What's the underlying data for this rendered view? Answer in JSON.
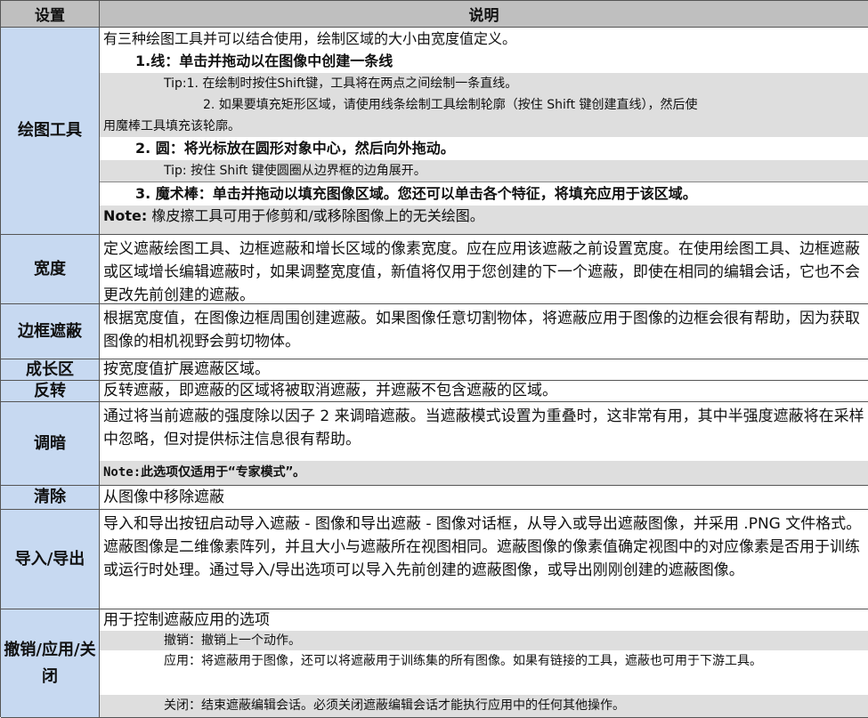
{
  "header": {
    "setting": "设置",
    "description": "说明"
  },
  "rows": {
    "draw": {
      "label": "绘图工具",
      "intro": "有三种绘图工具并可以结合使用，绘制区域的大小由宽度值定义。",
      "line_title": "1.线：单击并拖动以在图像中创建一条线",
      "line_tip1": "Tip:1. 在绘制时按住Shift键，工具将在两点之间绘制一条直线。",
      "line_tip2a": "2. 如果要填充矩形区域，请使用线条绘制工具绘制轮廓（按住 Shift 键创建直线），然后使",
      "line_tip2b": "用魔棒工具填充该轮廓。",
      "circle_title": "2. 圆：将光标放在圆形对象中心，然后向外拖动。",
      "circle_tip": "Tip: 按住 Shift 键使圆圈从边界框的边角展开。",
      "wand_title": "3. 魔术棒：单击并拖动以填充图像区域。您还可以单击各个特征，将填充应用于该区域。",
      "note_label": "Note:",
      "note_text": " 橡皮擦工具可用于修剪和/或移除图像上的无关绘图。"
    },
    "width": {
      "label": "宽度",
      "text": "定义遮蔽绘图工具、边框遮蔽和增长区域的像素宽度。应在应用该遮蔽之前设置宽度。在使用绘图工具、边框遮蔽或区域增长编辑遮蔽时，如果调整宽度值，新值将仅用于您创建的下一个遮蔽，即使在相同的编辑会话，它也不会更改先前创建的遮蔽。"
    },
    "border": {
      "label": "边框遮蔽",
      "text": "根据宽度值，在图像边框周围创建遮蔽。如果图像任意切割物体，将遮蔽应用于图像的边框会很有帮助，因为获取图像的相机视野会剪切物体。"
    },
    "grow": {
      "label": "成长区",
      "text": "按宽度值扩展遮蔽区域。"
    },
    "invert": {
      "label": "反转",
      "text": "反转遮蔽，即遮蔽的区域将被取消遮蔽，并遮蔽不包含遮蔽的区域。"
    },
    "dim": {
      "label": "调暗",
      "text": "通过将当前遮蔽的强度除以因子 2 来调暗遮蔽。当遮蔽模式设置为重叠时，这非常有用，其中半强度遮蔽将在采样中忽略，但对提供标注信息很有帮助。",
      "note": "Note:此选项仅适用于“专家模式”。"
    },
    "clear": {
      "label": "清除",
      "text": "从图像中移除遮蔽"
    },
    "io": {
      "label": "导入/导出",
      "text": "导入和导出按钮启动导入遮蔽 - 图像和导出遮蔽 - 图像对话框，从导入或导出遮蔽图像，并采用 .PNG 文件格式。遮蔽图像是二维像素阵列，并且大小与遮蔽所在视图相同。遮蔽图像的像素值确定视图中的对应像素是否用于训练或运行时处理。通过导入/导出选项可以导入先前创建的遮蔽图像，或导出刚刚创建的遮蔽图像。"
    },
    "undo": {
      "label": "撤销/应用/关闭",
      "intro": "用于控制遮蔽应用的选项",
      "undo": "撤销：撤销上一个动作。",
      "apply": "应用：将遮蔽用于图像，还可以将遮蔽用于训练集的所有图像。如果有链接的工具，遮蔽也可用于下游工具。",
      "close": "关闭：结束遮蔽编辑会话。必须关闭遮蔽编辑会话才能执行应用中的任何其他操作。"
    }
  },
  "colors": {
    "header_bg": "#bfbfbf",
    "label_bg": "#c7d9f1",
    "highlight_bg": "#dedede"
  }
}
